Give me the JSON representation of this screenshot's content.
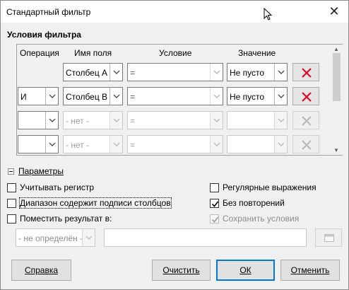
{
  "window": {
    "title": "Стандартный фильтр"
  },
  "section_title": "Условия фильтра",
  "columns": {
    "operation": "Операция",
    "field_name": "Имя поля",
    "condition": "Условие",
    "value": "Значение"
  },
  "rows": [
    {
      "operation": "",
      "field": "Столбец A",
      "condition": "=",
      "value": "Не пусто",
      "enabled": true,
      "operation_shown": false
    },
    {
      "operation": "И",
      "field": "Столбец B",
      "condition": "=",
      "value": "Не пусто",
      "enabled": true,
      "operation_shown": true
    },
    {
      "operation": "",
      "field": "- нет -",
      "condition": "=",
      "value": "",
      "enabled": false,
      "operation_shown": true
    },
    {
      "operation": "",
      "field": "- нет -",
      "condition": "=",
      "value": "",
      "enabled": false,
      "operation_shown": true
    }
  ],
  "params": {
    "label": "Параметры",
    "case_sensitive": {
      "label": "Учитывать регистр",
      "checked": false
    },
    "contains_headers": {
      "label": "Диапазон содержит подписи столбцов",
      "checked": false
    },
    "copy_results": {
      "label": "Поместить результат в:",
      "checked": false
    },
    "regex": {
      "label": "Регулярные выражения",
      "checked": false
    },
    "no_duplicates": {
      "label": "Без повторений",
      "checked": true
    },
    "keep_filter": {
      "label": "Сохранить условия",
      "checked": true,
      "enabled": false
    },
    "target_select": "- не определён -",
    "target_field": ""
  },
  "buttons": {
    "help": "Справка",
    "clear": "Очистить",
    "ok": "ОК",
    "cancel": "Отменить"
  },
  "colors": {
    "remove_enabled": "#e0001b",
    "remove_disabled": "#b8b8b8",
    "default_button_border": "#0078d7"
  }
}
